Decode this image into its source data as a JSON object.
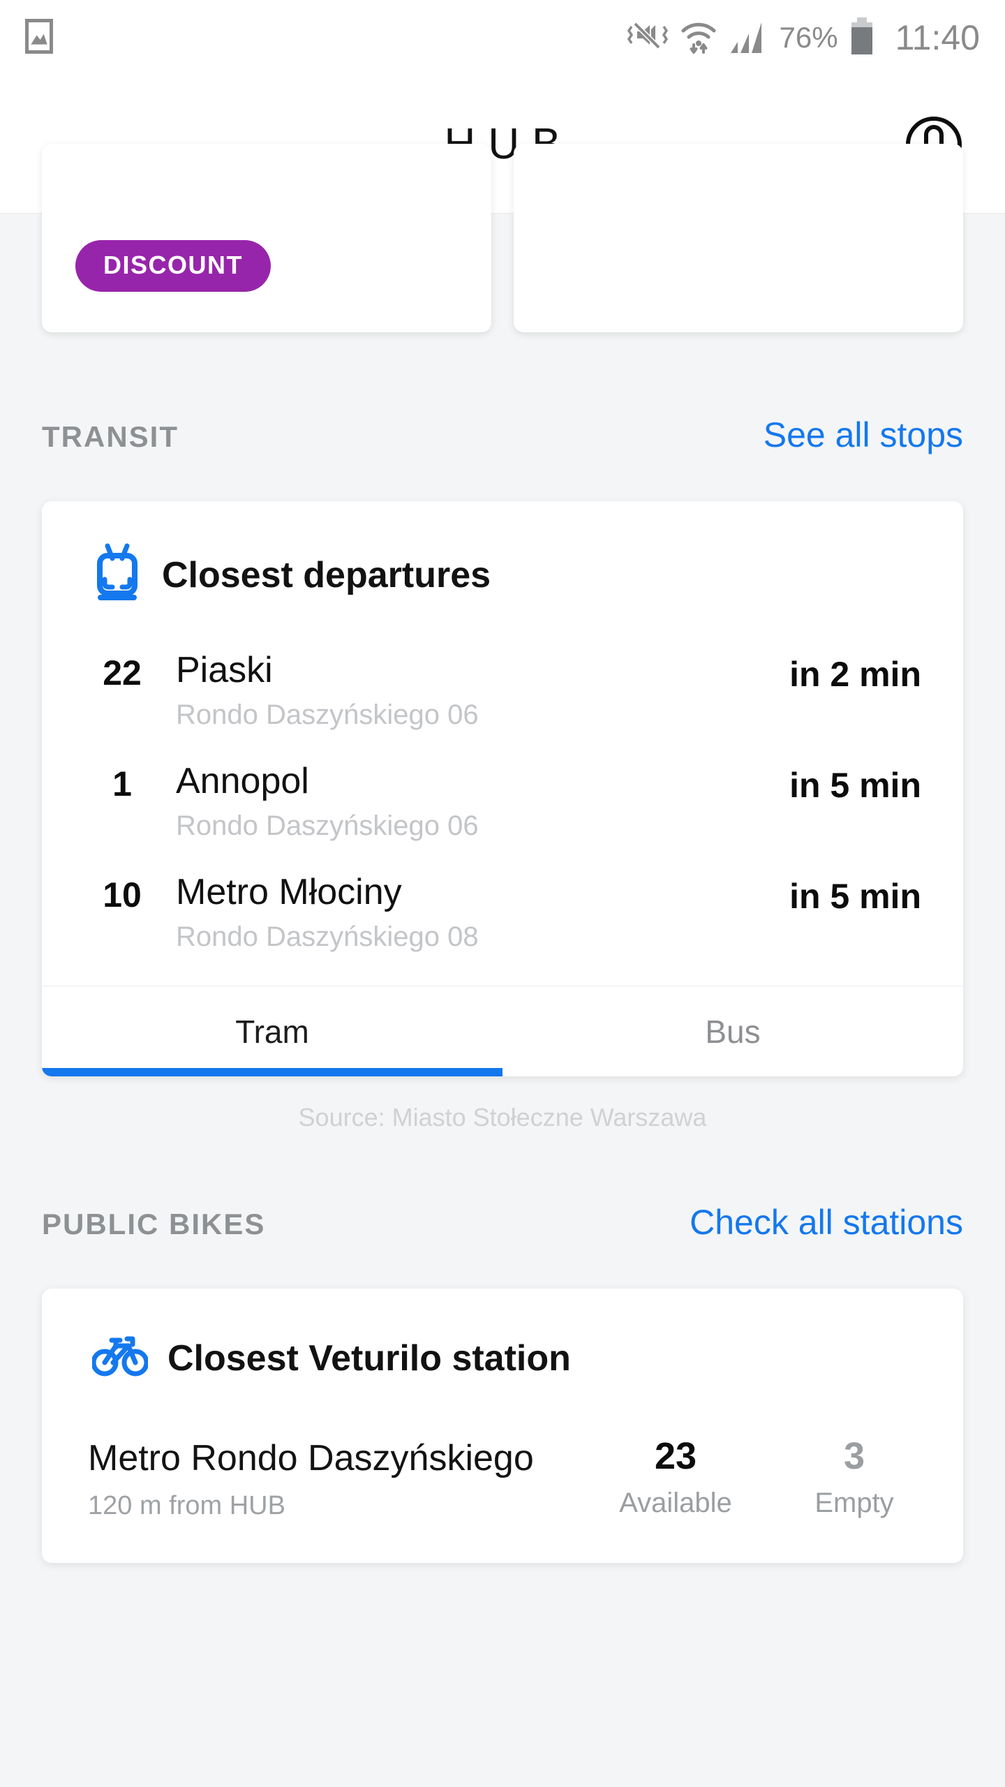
{
  "statusbar": {
    "time": "11:40",
    "battery_percent": "76%",
    "icons": [
      "image-gallery-icon",
      "vibrate-mute-icon",
      "wifi-icon",
      "signal-bars-icon",
      "battery-icon"
    ]
  },
  "appbar": {
    "title": "HUB",
    "account_icon": "account-circle-icon"
  },
  "promo": {
    "badge_label": "DISCOUNT",
    "badge_color": "#9725ab"
  },
  "transit": {
    "section_title": "TRANSIT",
    "see_all_label": "See all stops",
    "card_icon": "tram-icon",
    "card_title": "Closest departures",
    "departures": [
      {
        "line": "22",
        "destination": "Piaski",
        "stop": "Rondo Daszyńskiego 06",
        "eta": "in 2 min"
      },
      {
        "line": "1",
        "destination": "Annopol",
        "stop": "Rondo Daszyńskiego 06",
        "eta": "in 5 min"
      },
      {
        "line": "10",
        "destination": "Metro Młociny",
        "stop": "Rondo Daszyńskiego 08",
        "eta": "in 5 min"
      }
    ],
    "tabs": [
      {
        "label": "Tram",
        "active": true
      },
      {
        "label": "Bus",
        "active": false
      }
    ],
    "source": "Source: Miasto Stołeczne Warszawa"
  },
  "bikes": {
    "section_title": "PUBLIC BIKES",
    "check_all_label": "Check all stations",
    "card_icon": "bicycle-icon",
    "card_title": "Closest Veturilo station",
    "station_name": "Metro Rondo Daszyńskiego",
    "station_distance": "120 m from HUB",
    "available_count": "23",
    "available_label": "Available",
    "empty_count": "3",
    "empty_label": "Empty"
  },
  "colors": {
    "accent_blue": "#1478ee",
    "badge_purple": "#9725ab",
    "page_bg": "#f4f5f6"
  }
}
